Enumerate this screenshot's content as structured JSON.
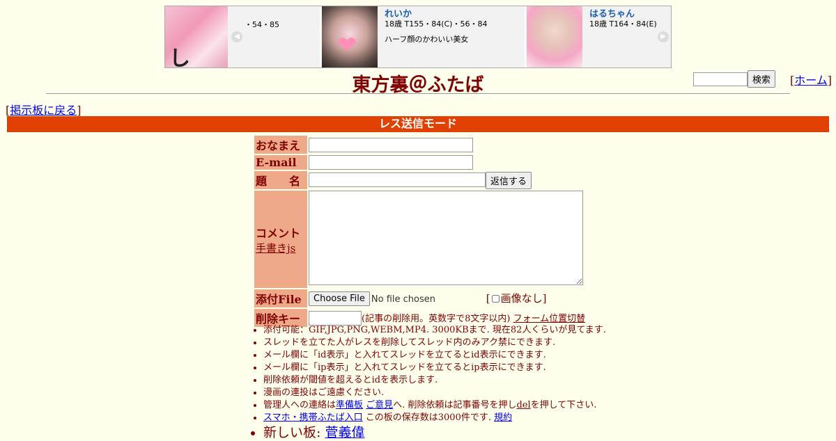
{
  "ad": {
    "logo_text": "し",
    "slide1_partial": "・54・85",
    "slide2_name": "れいか",
    "slide2_stats": "18歳 T155・84(C)・56・84",
    "slide2_desc": "ハーフ顔のかわいい美女",
    "slide3_name": "はるちゃん",
    "slide3_stats": "18歳 T164・84(E)"
  },
  "header": {
    "title": "東方裏＠ふたば",
    "search_button": "検索",
    "home_link": "ホーム",
    "back_link": "掲示板に戻る"
  },
  "mode_bar": "レス送信モード",
  "form": {
    "name_label": "おなまえ",
    "email_label": "E-mail",
    "subject_label": "題　　名",
    "submit_button": "返信する",
    "comment_label": "コメント",
    "handwrite_link": "手書きjs",
    "file_label": "添付File",
    "file_button": "Choose File",
    "file_status": "No file chosen",
    "no_image_label": "画像なし",
    "delkey_label": "削除キー",
    "delkey_note": "(記事の削除用。英数字で8文字以内)",
    "form_toggle_link": "フォーム位置切替"
  },
  "notes": {
    "n1": "添付可能：GIF,JPG,PNG,WEBM,MP4. 3000KBまで. 現在82人くらいが見てます.",
    "n2": "スレッドを立てた人がレスを削除してスレッド内のみアク禁にできます.",
    "n3": "メール欄に「id表示」と入れてスレッドを立てるとid表示にできます.",
    "n4": "メール欄に「ip表示」と入れてスレッドを立てるとip表示にできます.",
    "n5": "削除依頼が閾値を超えるとidを表示します.",
    "n6": "漫画の連投はご遠慮ください.",
    "n7_prefix": "管理人への連絡は",
    "n7_link1": "準備板",
    "n7_link2": "ご意見",
    "n7_mid": "へ. 削除依頼は記事番号を押し",
    "n7_link3": "del",
    "n7_suffix": "を押して下さい.",
    "n8_link1": "スマホ・携帯ふたば入口",
    "n8_mid": "この板の保存数は3000件です.",
    "n8_link2": "規約",
    "n9_prefix": "新しい板:",
    "n9_link": "菅義偉"
  }
}
